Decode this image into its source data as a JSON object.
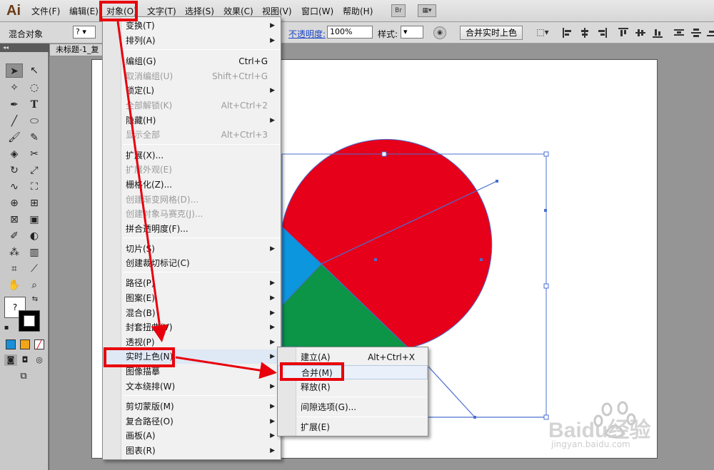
{
  "app": {
    "logo": "Ai"
  },
  "menubar": {
    "items": [
      "文件(F)",
      "编辑(E)",
      "对象(O)",
      "文字(T)",
      "选择(S)",
      "效果(C)",
      "视图(V)",
      "窗口(W)",
      "帮助(H)"
    ],
    "bridge_label": "Br"
  },
  "controlbar": {
    "selection_label": "混合对象",
    "opacity_label": "不透明度:",
    "opacity_value": "100%",
    "style_label": "样式:",
    "merge_live_paint_button": "合并实时上色"
  },
  "document": {
    "tab_title": "未标题-1_复"
  },
  "tools": {
    "fill_stroke_placeholder": "?",
    "style_box_placeholder": "?"
  },
  "object_menu": {
    "items": [
      {
        "label": "变换(T)",
        "shortcut": "",
        "submenu": true,
        "disabled": false
      },
      {
        "label": "排列(A)",
        "shortcut": "",
        "submenu": true,
        "disabled": false
      },
      {
        "label": "编组(G)",
        "shortcut": "Ctrl+G",
        "submenu": false,
        "disabled": false
      },
      {
        "label": "取消编组(U)",
        "shortcut": "Shift+Ctrl+G",
        "submenu": false,
        "disabled": true
      },
      {
        "label": "锁定(L)",
        "shortcut": "",
        "submenu": true,
        "disabled": false
      },
      {
        "label": "全部解锁(K)",
        "shortcut": "Alt+Ctrl+2",
        "submenu": false,
        "disabled": true
      },
      {
        "label": "隐藏(H)",
        "shortcut": "",
        "submenu": true,
        "disabled": false
      },
      {
        "label": "显示全部",
        "shortcut": "Alt+Ctrl+3",
        "submenu": false,
        "disabled": true
      },
      {
        "label": "扩展(X)...",
        "shortcut": "",
        "submenu": false,
        "disabled": false
      },
      {
        "label": "扩展外观(E)",
        "shortcut": "",
        "submenu": false,
        "disabled": true
      },
      {
        "label": "栅格化(Z)...",
        "shortcut": "",
        "submenu": false,
        "disabled": false
      },
      {
        "label": "创建渐变网格(D)...",
        "shortcut": "",
        "submenu": false,
        "disabled": true
      },
      {
        "label": "创建对象马赛克(J)...",
        "shortcut": "",
        "submenu": false,
        "disabled": true
      },
      {
        "label": "拼合透明度(F)...",
        "shortcut": "",
        "submenu": false,
        "disabled": false
      },
      {
        "label": "切片(S)",
        "shortcut": "",
        "submenu": true,
        "disabled": false
      },
      {
        "label": "创建裁切标记(C)",
        "shortcut": "",
        "submenu": false,
        "disabled": false
      },
      {
        "label": "路径(P)",
        "shortcut": "",
        "submenu": true,
        "disabled": false
      },
      {
        "label": "图案(E)",
        "shortcut": "",
        "submenu": true,
        "disabled": false
      },
      {
        "label": "混合(B)",
        "shortcut": "",
        "submenu": true,
        "disabled": false
      },
      {
        "label": "封套扭曲(V)",
        "shortcut": "",
        "submenu": true,
        "disabled": false
      },
      {
        "label": "透视(P)",
        "shortcut": "",
        "submenu": true,
        "disabled": false
      },
      {
        "label": "实时上色(N)",
        "shortcut": "",
        "submenu": true,
        "disabled": false
      },
      {
        "label": "图像描摹",
        "shortcut": "",
        "submenu": true,
        "disabled": false
      },
      {
        "label": "文本绕排(W)",
        "shortcut": "",
        "submenu": true,
        "disabled": false
      },
      {
        "label": "剪切蒙版(M)",
        "shortcut": "",
        "submenu": true,
        "disabled": false
      },
      {
        "label": "复合路径(O)",
        "shortcut": "",
        "submenu": true,
        "disabled": false
      },
      {
        "label": "画板(A)",
        "shortcut": "",
        "submenu": true,
        "disabled": false
      },
      {
        "label": "图表(R)",
        "shortcut": "",
        "submenu": true,
        "disabled": false
      }
    ]
  },
  "live_paint_submenu": {
    "items": [
      {
        "label": "建立(A)",
        "shortcut": "Alt+Ctrl+X"
      },
      {
        "label": "合并(M)",
        "shortcut": ""
      },
      {
        "label": "释放(R)",
        "shortcut": ""
      },
      {
        "label": "间隙选项(G)...",
        "shortcut": ""
      },
      {
        "label": "扩展(E)",
        "shortcut": ""
      }
    ]
  },
  "icons": [
    "selection-arrow-icon",
    "direct-selection-icon",
    "pen-icon",
    "type-icon",
    "line-icon",
    "ellipse-icon",
    "brush-icon",
    "pencil-icon",
    "eraser-icon",
    "scissors-icon",
    "rotate-icon",
    "scale-icon",
    "warp-icon",
    "free-transform-icon",
    "shape-builder-icon",
    "perspective-icon",
    "mesh-icon",
    "gradient-icon",
    "eyedropper-icon",
    "blend-icon",
    "symbol-sprayer-icon",
    "column-graph-icon",
    "artboard-icon",
    "slice-icon",
    "hand-icon",
    "zoom-icon"
  ],
  "colors": {
    "pie_red": "#e6001a",
    "pie_green": "#0c9447",
    "pie_blue": "#0b96de",
    "highlight_red": "#e8000c",
    "selection_blue": "#4a6fd0"
  },
  "watermark": {
    "brand": "Baidu经验",
    "url": "jingyan.baidu.com"
  }
}
